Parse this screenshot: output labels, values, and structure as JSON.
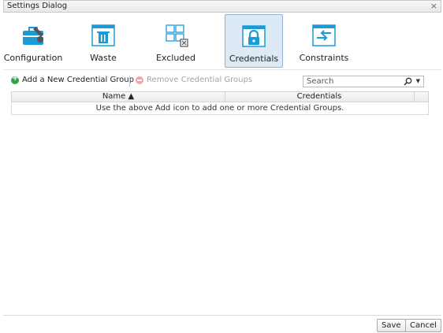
{
  "window": {
    "title": "Settings Dialog",
    "close_glyph": "×"
  },
  "toolbar": {
    "items": [
      {
        "label": "Configuration",
        "icon": "configuration-icon",
        "active": false
      },
      {
        "label": "Waste",
        "icon": "trash-icon",
        "active": false
      },
      {
        "label": "Excluded",
        "icon": "excluded-icon",
        "active": false
      },
      {
        "label": "Credentials",
        "icon": "lock-icon",
        "active": true
      },
      {
        "label": "Constraints",
        "icon": "constraints-icon",
        "active": false
      }
    ]
  },
  "actions": {
    "add_label": "Add a New Credential Group",
    "remove_label": "Remove Credential Groups"
  },
  "search": {
    "placeholder": "Search"
  },
  "grid": {
    "columns": [
      {
        "label": "Name ▲"
      },
      {
        "label": "Credentials"
      }
    ],
    "empty_message": "Use the above Add icon to add one or more Credential Groups."
  },
  "footer": {
    "save_label": "Save",
    "cancel_label": "Cancel"
  },
  "colors": {
    "accent": "#1a9bd7",
    "active_bg": "#dde9f5",
    "add_green": "#36a14a"
  }
}
